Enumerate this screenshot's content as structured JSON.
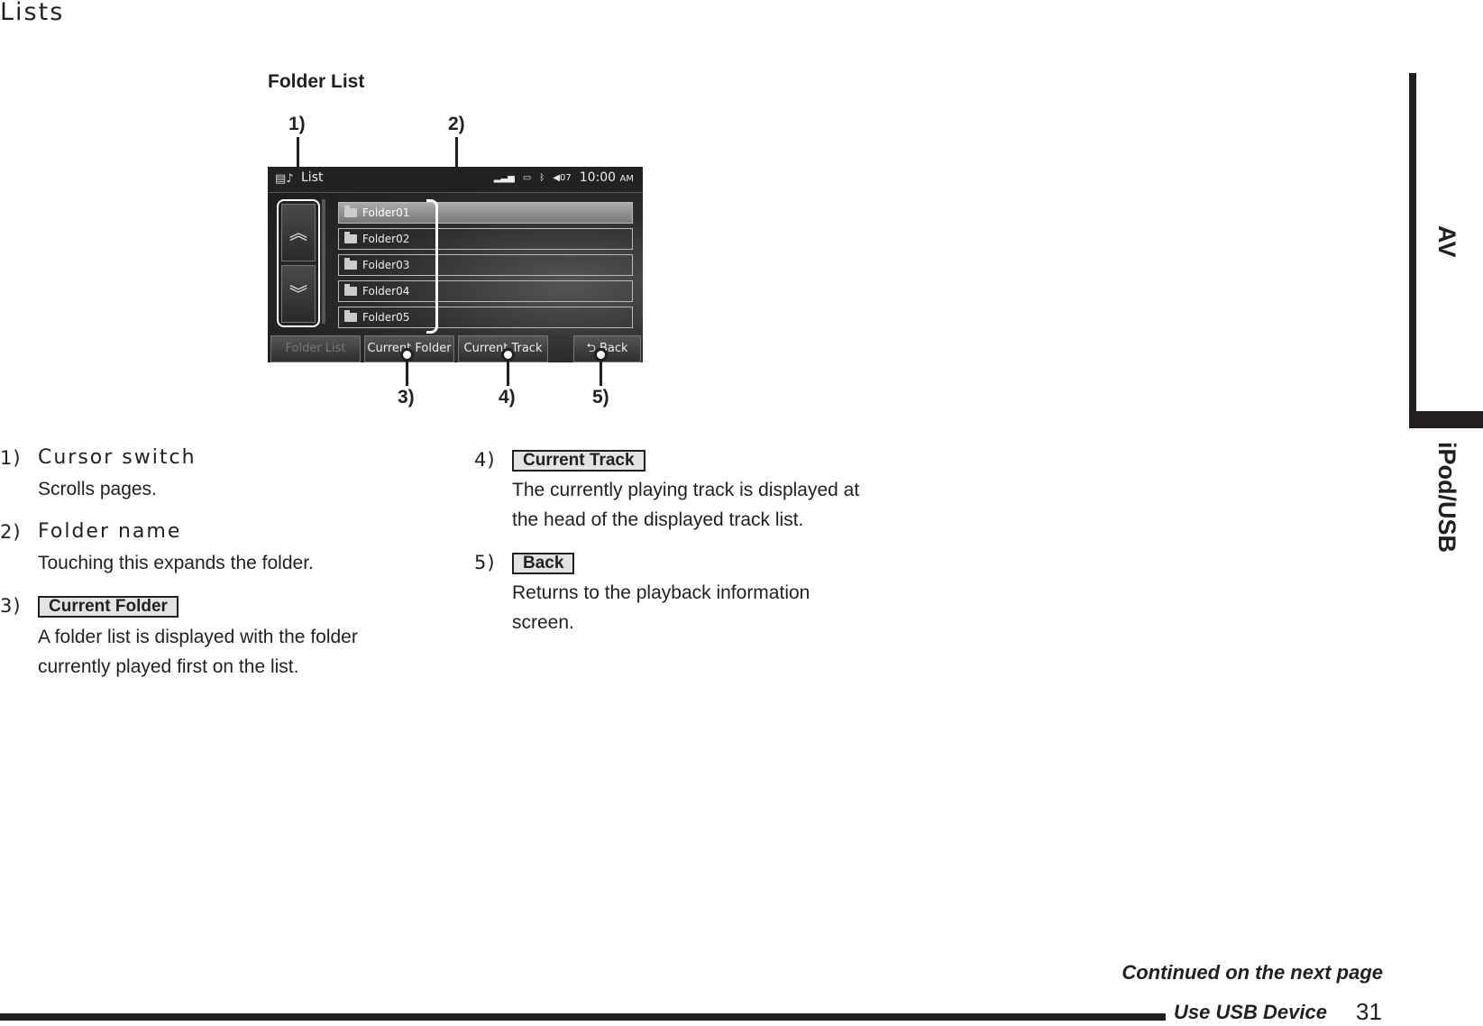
{
  "page": {
    "title": "Lists",
    "figure_title": "Folder List",
    "callouts": [
      "1)",
      "2)",
      "3)",
      "4)",
      "5)"
    ]
  },
  "device_screen": {
    "header": {
      "list_icon": "list-music-icon",
      "title": "List",
      "signal_icon": "signal-bars-icon",
      "battery_icon": "battery-icon",
      "bluetooth_icon": "bluetooth-icon",
      "volume_icon": "speaker-icon",
      "volume": "07",
      "time": "10:00",
      "ampm": "AM"
    },
    "scroll_up_icon": "double-chevron-up-icon",
    "scroll_down_icon": "double-chevron-down-icon",
    "folders": [
      {
        "name": "Folder01",
        "selected": true
      },
      {
        "name": "Folder02",
        "selected": false
      },
      {
        "name": "Folder03",
        "selected": false
      },
      {
        "name": "Folder04",
        "selected": false
      },
      {
        "name": "Folder05",
        "selected": false
      }
    ],
    "buttons": {
      "folder_list": "Folder List",
      "current_folder": "Current Folder",
      "current_track": "Current Track",
      "back": "Back",
      "back_icon": "return-arrow-icon"
    }
  },
  "descriptions": [
    {
      "num": "1)",
      "heading": "Cursor switch",
      "lines": [
        "Scrolls pages."
      ]
    },
    {
      "num": "2)",
      "heading": "Folder name",
      "lines": [
        "Touching this expands the folder."
      ]
    },
    {
      "num": "3)",
      "key": "Current Folder",
      "lines": [
        "A folder list is displayed with the folder",
        "currently played first on the list."
      ]
    },
    {
      "num": "4)",
      "key": "Current Track",
      "lines": [
        "The currently playing track is displayed at",
        "the head of the displayed track list."
      ]
    },
    {
      "num": "5)",
      "key": "Back",
      "lines": [
        "Returns to the playback information",
        "screen."
      ]
    }
  ],
  "side_tabs": {
    "av": "AV",
    "ipod_usb": "iPod/USB"
  },
  "footer": {
    "continued": "Continued on the next page",
    "section": "Use USB Device",
    "page_number": "31"
  }
}
